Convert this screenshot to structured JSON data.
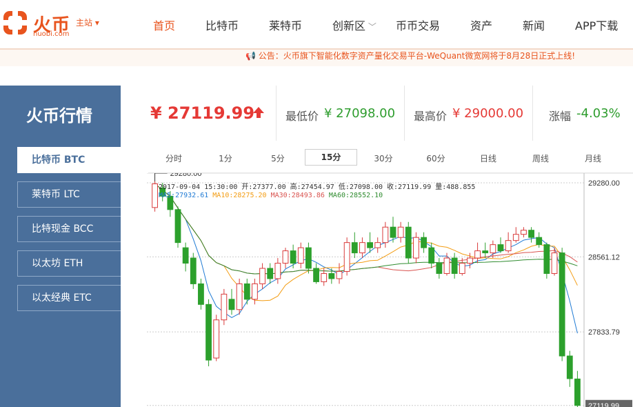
{
  "header": {
    "logo_text": "火币",
    "logo_sub": "huobi.com",
    "site_switch": "主站",
    "nav": [
      "首页",
      "比特币",
      "莱特币",
      "创新区",
      "币币交易",
      "资产",
      "新闻",
      "APP下载"
    ],
    "notice": "公告：火币旗下智能化数字资产量化交易平台-WeQuant微宽网将于8月28日正式上线!"
  },
  "sidebar": {
    "title": "火币行情",
    "items": [
      "比特币 BTC",
      "莱特币 LTC",
      "比特现金 BCC",
      "以太坊 ETH",
      "以太经典 ETC"
    ]
  },
  "stats": {
    "price": "¥ 27119.99",
    "low_label": "最低价",
    "low_value": "¥ 27098.00",
    "high_label": "最高价",
    "high_value": "¥ 29000.00",
    "change_label": "涨幅",
    "change_value": "-4.03%"
  },
  "tabs": [
    "分时",
    "1分",
    "5分",
    "15分",
    "30分",
    "60分",
    "日线",
    "周线",
    "月线"
  ],
  "colors": {
    "accent": "#e8541e",
    "up": "#d93a3a",
    "down": "#2ca02c",
    "sidebar": "#4a6f9b"
  },
  "chart_data": {
    "type": "candlestick",
    "info": "2017-09-04 15:30:00  开:27377.00 高:27454.97 低:27098.00 收:27119.99 量:488.855",
    "ma_labels": [
      {
        "text": "MA5:27932.61",
        "color": "#1f7ad4"
      },
      {
        "text": "MA10:28275.20",
        "color": "#f39c12"
      },
      {
        "text": "MA30:28493.86",
        "color": "#d9534f"
      },
      {
        "text": "MA60:28552.10",
        "color": "#2e8b2e"
      }
    ],
    "y_ticks": [
      "29280.00",
      "28561.12",
      "27833.79",
      "27119.99"
    ],
    "high_marker": "29280.00",
    "ylim": [
      27105,
      29340
    ],
    "candles": [
      [
        29040,
        29270,
        29300,
        29000
      ],
      [
        29230,
        29150,
        29280,
        29100
      ],
      [
        29150,
        29020,
        29200,
        28950
      ],
      [
        29020,
        28700,
        29050,
        28650
      ],
      [
        28650,
        28500,
        28700,
        28420
      ],
      [
        28550,
        28300,
        28600,
        28250
      ],
      [
        28300,
        28100,
        28350,
        28050
      ],
      [
        28100,
        27560,
        28150,
        27500
      ],
      [
        27580,
        27950,
        28000,
        27550
      ],
      [
        27950,
        28200,
        28250,
        27900
      ],
      [
        28150,
        28050,
        28250,
        28000
      ],
      [
        28050,
        28300,
        28350,
        28000
      ],
      [
        28300,
        28150,
        28350,
        28100
      ],
      [
        28150,
        28300,
        28350,
        28100
      ],
      [
        28300,
        28450,
        28500,
        28250
      ],
      [
        28450,
        28350,
        28500,
        28300
      ],
      [
        28350,
        28500,
        28550,
        28300
      ],
      [
        28500,
        28620,
        28650,
        28450
      ],
      [
        28620,
        28500,
        28680,
        28450
      ],
      [
        28500,
        28650,
        28700,
        28450
      ],
      [
        28650,
        28450,
        28700,
        28400
      ],
      [
        28450,
        28320,
        28500,
        28300
      ],
      [
        28320,
        28400,
        28450,
        28280
      ],
      [
        28400,
        28350,
        28450,
        28300
      ],
      [
        28350,
        28420,
        28500,
        28300
      ],
      [
        28420,
        28700,
        28750,
        28380
      ],
      [
        28700,
        28600,
        28800,
        28550
      ],
      [
        28600,
        28700,
        28750,
        28550
      ],
      [
        28700,
        28650,
        28800,
        28600
      ],
      [
        28650,
        28700,
        28750,
        28600
      ],
      [
        28700,
        28850,
        28900,
        28650
      ],
      [
        28850,
        28750,
        28950,
        28700
      ],
      [
        28750,
        28850,
        28900,
        28700
      ],
      [
        28850,
        28550,
        28900,
        28500
      ],
      [
        28550,
        28750,
        28800,
        28500
      ],
      [
        28750,
        28650,
        28800,
        28600
      ],
      [
        28650,
        28500,
        28700,
        28450
      ],
      [
        28500,
        28400,
        28550,
        28350
      ],
      [
        28400,
        28550,
        28600,
        28380
      ],
      [
        28550,
        28400,
        28600,
        28350
      ],
      [
        28400,
        28500,
        28550,
        28380
      ],
      [
        28500,
        28550,
        28600,
        28450
      ],
      [
        28550,
        28620,
        28700,
        28500
      ],
      [
        28620,
        28600,
        28700,
        28550
      ],
      [
        28600,
        28680,
        28720,
        28550
      ],
      [
        28680,
        28620,
        28750,
        28600
      ],
      [
        28620,
        28720,
        28800,
        28600
      ],
      [
        28720,
        28780,
        28850,
        28700
      ],
      [
        28780,
        28820,
        28850,
        28750
      ],
      [
        28820,
        28750,
        28850,
        28700
      ],
      [
        28750,
        28680,
        28800,
        28650
      ],
      [
        28680,
        28400,
        28700,
        28350
      ],
      [
        28400,
        28600,
        28650,
        28380
      ],
      [
        28600,
        27600,
        28650,
        27550
      ],
      [
        27600,
        27380,
        27650,
        27300
      ],
      [
        27377,
        27120,
        27455,
        27098
      ]
    ]
  }
}
